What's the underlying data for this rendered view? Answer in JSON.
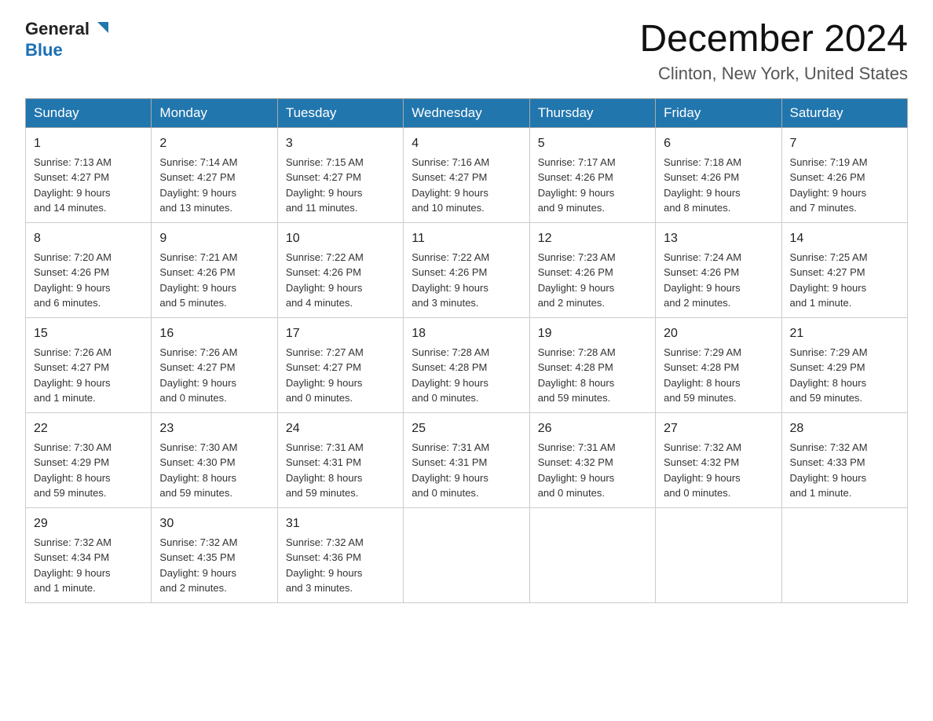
{
  "header": {
    "logo_general": "General",
    "logo_blue": "Blue",
    "main_title": "December 2024",
    "subtitle": "Clinton, New York, United States"
  },
  "calendar": {
    "days_of_week": [
      "Sunday",
      "Monday",
      "Tuesday",
      "Wednesday",
      "Thursday",
      "Friday",
      "Saturday"
    ],
    "weeks": [
      [
        {
          "day": "1",
          "info": "Sunrise: 7:13 AM\nSunset: 4:27 PM\nDaylight: 9 hours\nand 14 minutes."
        },
        {
          "day": "2",
          "info": "Sunrise: 7:14 AM\nSunset: 4:27 PM\nDaylight: 9 hours\nand 13 minutes."
        },
        {
          "day": "3",
          "info": "Sunrise: 7:15 AM\nSunset: 4:27 PM\nDaylight: 9 hours\nand 11 minutes."
        },
        {
          "day": "4",
          "info": "Sunrise: 7:16 AM\nSunset: 4:27 PM\nDaylight: 9 hours\nand 10 minutes."
        },
        {
          "day": "5",
          "info": "Sunrise: 7:17 AM\nSunset: 4:26 PM\nDaylight: 9 hours\nand 9 minutes."
        },
        {
          "day": "6",
          "info": "Sunrise: 7:18 AM\nSunset: 4:26 PM\nDaylight: 9 hours\nand 8 minutes."
        },
        {
          "day": "7",
          "info": "Sunrise: 7:19 AM\nSunset: 4:26 PM\nDaylight: 9 hours\nand 7 minutes."
        }
      ],
      [
        {
          "day": "8",
          "info": "Sunrise: 7:20 AM\nSunset: 4:26 PM\nDaylight: 9 hours\nand 6 minutes."
        },
        {
          "day": "9",
          "info": "Sunrise: 7:21 AM\nSunset: 4:26 PM\nDaylight: 9 hours\nand 5 minutes."
        },
        {
          "day": "10",
          "info": "Sunrise: 7:22 AM\nSunset: 4:26 PM\nDaylight: 9 hours\nand 4 minutes."
        },
        {
          "day": "11",
          "info": "Sunrise: 7:22 AM\nSunset: 4:26 PM\nDaylight: 9 hours\nand 3 minutes."
        },
        {
          "day": "12",
          "info": "Sunrise: 7:23 AM\nSunset: 4:26 PM\nDaylight: 9 hours\nand 2 minutes."
        },
        {
          "day": "13",
          "info": "Sunrise: 7:24 AM\nSunset: 4:26 PM\nDaylight: 9 hours\nand 2 minutes."
        },
        {
          "day": "14",
          "info": "Sunrise: 7:25 AM\nSunset: 4:27 PM\nDaylight: 9 hours\nand 1 minute."
        }
      ],
      [
        {
          "day": "15",
          "info": "Sunrise: 7:26 AM\nSunset: 4:27 PM\nDaylight: 9 hours\nand 1 minute."
        },
        {
          "day": "16",
          "info": "Sunrise: 7:26 AM\nSunset: 4:27 PM\nDaylight: 9 hours\nand 0 minutes."
        },
        {
          "day": "17",
          "info": "Sunrise: 7:27 AM\nSunset: 4:27 PM\nDaylight: 9 hours\nand 0 minutes."
        },
        {
          "day": "18",
          "info": "Sunrise: 7:28 AM\nSunset: 4:28 PM\nDaylight: 9 hours\nand 0 minutes."
        },
        {
          "day": "19",
          "info": "Sunrise: 7:28 AM\nSunset: 4:28 PM\nDaylight: 8 hours\nand 59 minutes."
        },
        {
          "day": "20",
          "info": "Sunrise: 7:29 AM\nSunset: 4:28 PM\nDaylight: 8 hours\nand 59 minutes."
        },
        {
          "day": "21",
          "info": "Sunrise: 7:29 AM\nSunset: 4:29 PM\nDaylight: 8 hours\nand 59 minutes."
        }
      ],
      [
        {
          "day": "22",
          "info": "Sunrise: 7:30 AM\nSunset: 4:29 PM\nDaylight: 8 hours\nand 59 minutes."
        },
        {
          "day": "23",
          "info": "Sunrise: 7:30 AM\nSunset: 4:30 PM\nDaylight: 8 hours\nand 59 minutes."
        },
        {
          "day": "24",
          "info": "Sunrise: 7:31 AM\nSunset: 4:31 PM\nDaylight: 8 hours\nand 59 minutes."
        },
        {
          "day": "25",
          "info": "Sunrise: 7:31 AM\nSunset: 4:31 PM\nDaylight: 9 hours\nand 0 minutes."
        },
        {
          "day": "26",
          "info": "Sunrise: 7:31 AM\nSunset: 4:32 PM\nDaylight: 9 hours\nand 0 minutes."
        },
        {
          "day": "27",
          "info": "Sunrise: 7:32 AM\nSunset: 4:32 PM\nDaylight: 9 hours\nand 0 minutes."
        },
        {
          "day": "28",
          "info": "Sunrise: 7:32 AM\nSunset: 4:33 PM\nDaylight: 9 hours\nand 1 minute."
        }
      ],
      [
        {
          "day": "29",
          "info": "Sunrise: 7:32 AM\nSunset: 4:34 PM\nDaylight: 9 hours\nand 1 minute."
        },
        {
          "day": "30",
          "info": "Sunrise: 7:32 AM\nSunset: 4:35 PM\nDaylight: 9 hours\nand 2 minutes."
        },
        {
          "day": "31",
          "info": "Sunrise: 7:32 AM\nSunset: 4:36 PM\nDaylight: 9 hours\nand 3 minutes."
        },
        {
          "day": "",
          "info": ""
        },
        {
          "day": "",
          "info": ""
        },
        {
          "day": "",
          "info": ""
        },
        {
          "day": "",
          "info": ""
        }
      ]
    ]
  }
}
